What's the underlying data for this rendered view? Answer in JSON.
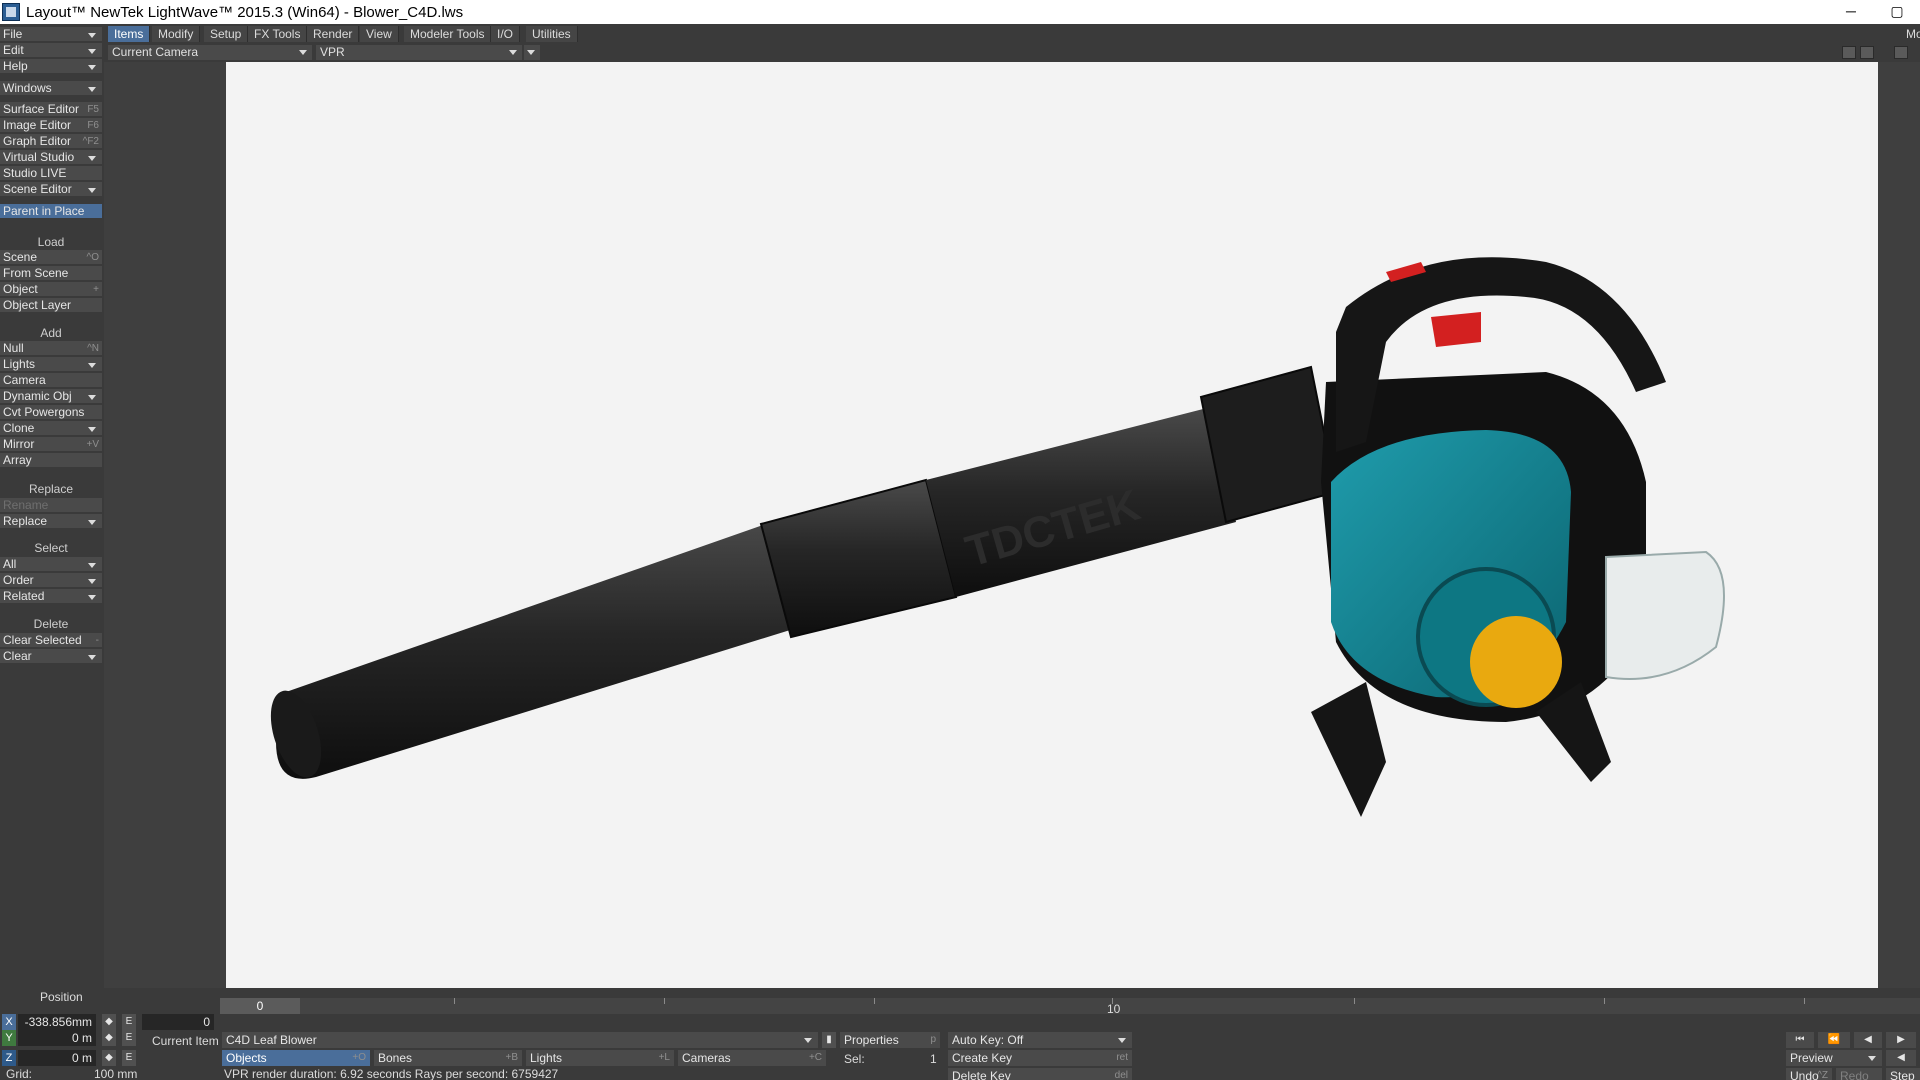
{
  "window": {
    "title": "Layout™ NewTek LightWave™ 2015.3 (Win64) - Blower_C4D.lws",
    "minimize": "─",
    "restore": "▢"
  },
  "sidebar": {
    "file": "File",
    "edit": "Edit",
    "help": "Help",
    "windows": "Windows",
    "surface_editor": "Surface Editor",
    "surface_editor_sc": "F5",
    "image_editor": "Image Editor",
    "image_editor_sc": "F6",
    "graph_editor": "Graph Editor",
    "graph_editor_sc": "^F2",
    "virtual_studio": "Virtual Studio",
    "studio_live": "Studio LIVE",
    "scene_editor": "Scene Editor",
    "parent_in_place": "Parent in Place",
    "load_head": "Load",
    "scene": "Scene",
    "scene_sc": "^O",
    "from_scene": "From Scene",
    "object": "Object",
    "object_sc": "+",
    "object_layer": "Object Layer",
    "add_head": "Add",
    "null": "Null",
    "null_sc": "^N",
    "lights": "Lights",
    "camera": "Camera",
    "dynamic_obj": "Dynamic Obj",
    "cvt_powergons": "Cvt Powergons",
    "clone": "Clone",
    "mirror": "Mirror",
    "mirror_sc": "+V",
    "array": "Array",
    "replace_head": "Replace",
    "rename": "Rename",
    "replace": "Replace",
    "select_head": "Select",
    "all": "All",
    "order": "Order",
    "related": "Related",
    "delete_head": "Delete",
    "clear_selected": "Clear Selected",
    "clear_selected_sc": "-",
    "clear": "Clear"
  },
  "tabs": [
    "Items",
    "Modify",
    "Setup",
    "FX Tools",
    "Render",
    "View",
    "Modeler Tools",
    "I/O",
    "Utilities"
  ],
  "tabbar_right": "Mo",
  "viewport": {
    "view": "Current Camera",
    "mode": "VPR",
    "brand_text": "TDCTEK"
  },
  "timeline": {
    "current_frame": "0",
    "label_0": "0",
    "label_10": "10"
  },
  "bottom": {
    "position_label": "Position",
    "x_label": "X",
    "y_label": "Y",
    "z_label": "Z",
    "x_value": "-338.856mm",
    "y_value": "0 m",
    "z_value": "0 m",
    "e_label": "E",
    "frame_field": "0",
    "grid_label": "Grid:",
    "grid_value": "100 mm",
    "current_item_label": "Current Item",
    "current_item_value": "C4D Leaf Blower",
    "objects": "Objects",
    "objects_sc": "+O",
    "bones": "Bones",
    "bones_sc": "+B",
    "lights": "Lights",
    "lights_sc": "+L",
    "cameras": "Cameras",
    "cameras_sc": "+C",
    "properties": "Properties",
    "properties_sc": "p",
    "sel_label": "Sel:",
    "sel_value": "1",
    "auto_key": "Auto Key: Off",
    "create_key": "Create Key",
    "create_key_sc": "ret",
    "delete_key": "Delete Key",
    "delete_key_sc": "del",
    "status": "VPR render duration: 6.92 seconds  Rays per second: 6759427",
    "preview": "Preview",
    "undo": "Undo",
    "undo_sc": "^Z",
    "redo": "Redo",
    "step": "Step"
  }
}
